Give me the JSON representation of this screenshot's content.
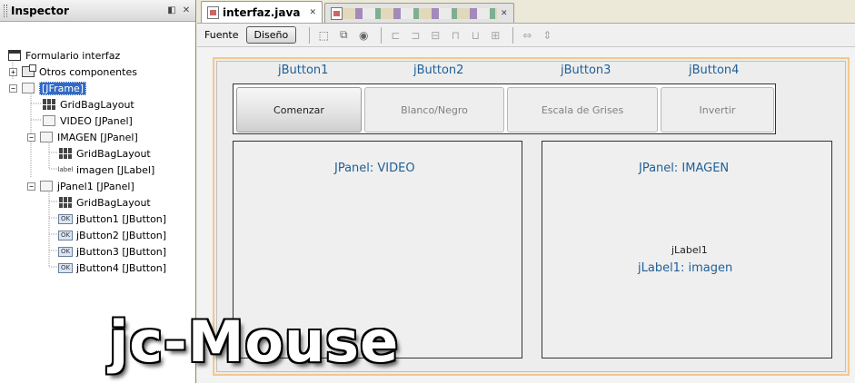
{
  "inspector": {
    "title": "Inspector",
    "tree": [
      {
        "label": "Formulario interfaz",
        "icon": "form-icon"
      },
      {
        "label": "Otros componentes",
        "icon": "other-components-icon"
      },
      {
        "label": "[JFrame]",
        "icon": "frame-icon",
        "selected": true
      },
      {
        "label": "GridBagLayout",
        "icon": "gridbaglayout-icon"
      },
      {
        "label": "VIDEO [JPanel]",
        "icon": "jpanel-icon"
      },
      {
        "label": "IMAGEN [JPanel]",
        "icon": "jpanel-icon"
      },
      {
        "label": "GridBagLayout",
        "icon": "gridbaglayout-icon"
      },
      {
        "label": "imagen [JLabel]",
        "icon": "jlabel-icon",
        "icon_text": "label"
      },
      {
        "label": "jPanel1 [JPanel]",
        "icon": "jpanel-icon"
      },
      {
        "label": "GridBagLayout",
        "icon": "gridbaglayout-icon"
      },
      {
        "label": "jButton1 [JButton]",
        "icon": "jbutton-icon",
        "icon_text": "OK"
      },
      {
        "label": "jButton2 [JButton]",
        "icon": "jbutton-icon",
        "icon_text": "OK"
      },
      {
        "label": "jButton3 [JButton]",
        "icon": "jbutton-icon",
        "icon_text": "OK"
      },
      {
        "label": "jButton4 [JButton]",
        "icon": "jbutton-icon",
        "icon_text": "OK"
      }
    ]
  },
  "editor": {
    "tabs": [
      {
        "title": "interfaz.java",
        "active": true
      }
    ],
    "toolbar": {
      "source_label": "Fuente",
      "design_label": "Diseño"
    }
  },
  "form": {
    "button_names": [
      "jButton1",
      "jButton2",
      "jButton3",
      "jButton4"
    ],
    "buttons": [
      "Comenzar",
      "Blanco/Negro",
      "Escala de Grises",
      "Invertir"
    ],
    "video_panel_label": "JPanel: VIDEO",
    "image_panel_label": "JPanel: IMAGEN",
    "jlabel_text": "jLabel1",
    "jlabel_caption": "jLabel1: imagen"
  },
  "watermark": "jc-Mouse",
  "colors": {
    "label_blue": "#1f5f97",
    "selection_blue": "#316ac5",
    "canvas_border": "#f2c98c"
  }
}
